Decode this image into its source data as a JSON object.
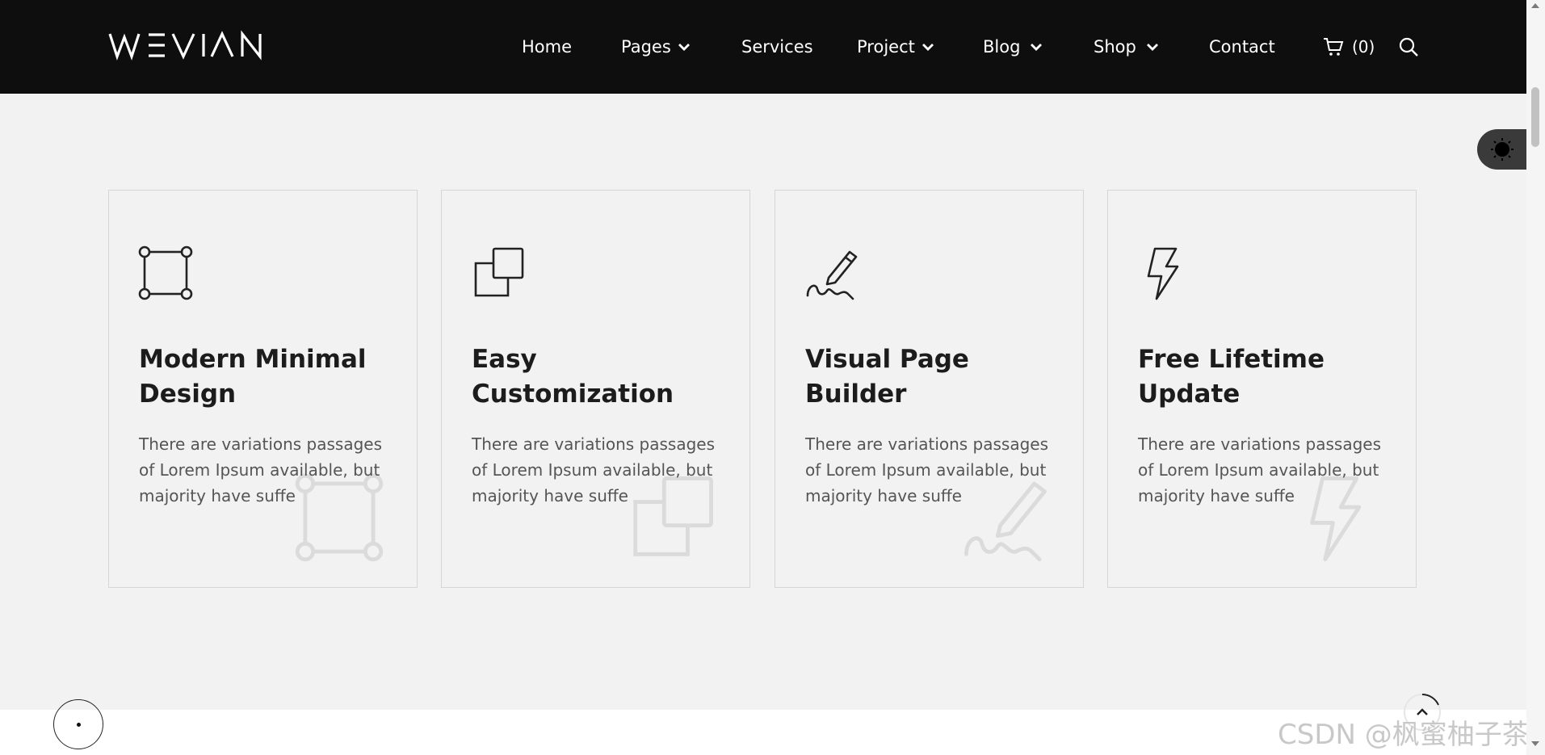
{
  "brand": {
    "logo_text": "WEVIAN"
  },
  "nav": {
    "items": [
      {
        "label": "Home",
        "has_dropdown": false
      },
      {
        "label": "Pages",
        "has_dropdown": true
      },
      {
        "label": "Services",
        "has_dropdown": false
      },
      {
        "label": "Project",
        "has_dropdown": true
      },
      {
        "label": "Blog",
        "has_dropdown": true
      },
      {
        "label": "Shop",
        "has_dropdown": true
      },
      {
        "label": "Contact",
        "has_dropdown": false
      }
    ],
    "cart_count": "(0)",
    "cart_icon": "cart-icon",
    "search_icon": "search-icon"
  },
  "mode_toggle": {
    "icon": "sun-icon"
  },
  "features": [
    {
      "icon": "square-nodes-icon",
      "title": "Modern Minimal Design",
      "description": "There are variations passages of Lorem Ipsum available, but majority have suffe"
    },
    {
      "icon": "copy-icon",
      "title": "Easy Customization",
      "description": "There are variations passages of Lorem Ipsum available, but majority have suffe"
    },
    {
      "icon": "signature-pen-icon",
      "title": "Visual Page Builder",
      "description": "There are variations passages of Lorem Ipsum available, but majority have suffe"
    },
    {
      "icon": "lightning-icon",
      "title": "Free Lifetime Update",
      "description": "There are variations passages of Lorem Ipsum available, but majority have suffe"
    }
  ],
  "watermark": "CSDN @枫蜜柚子茶",
  "colors": {
    "header_bg": "#0e0e0e",
    "page_bg": "#f2f2f2",
    "text": "#1c1c1c",
    "muted": "#555555"
  }
}
